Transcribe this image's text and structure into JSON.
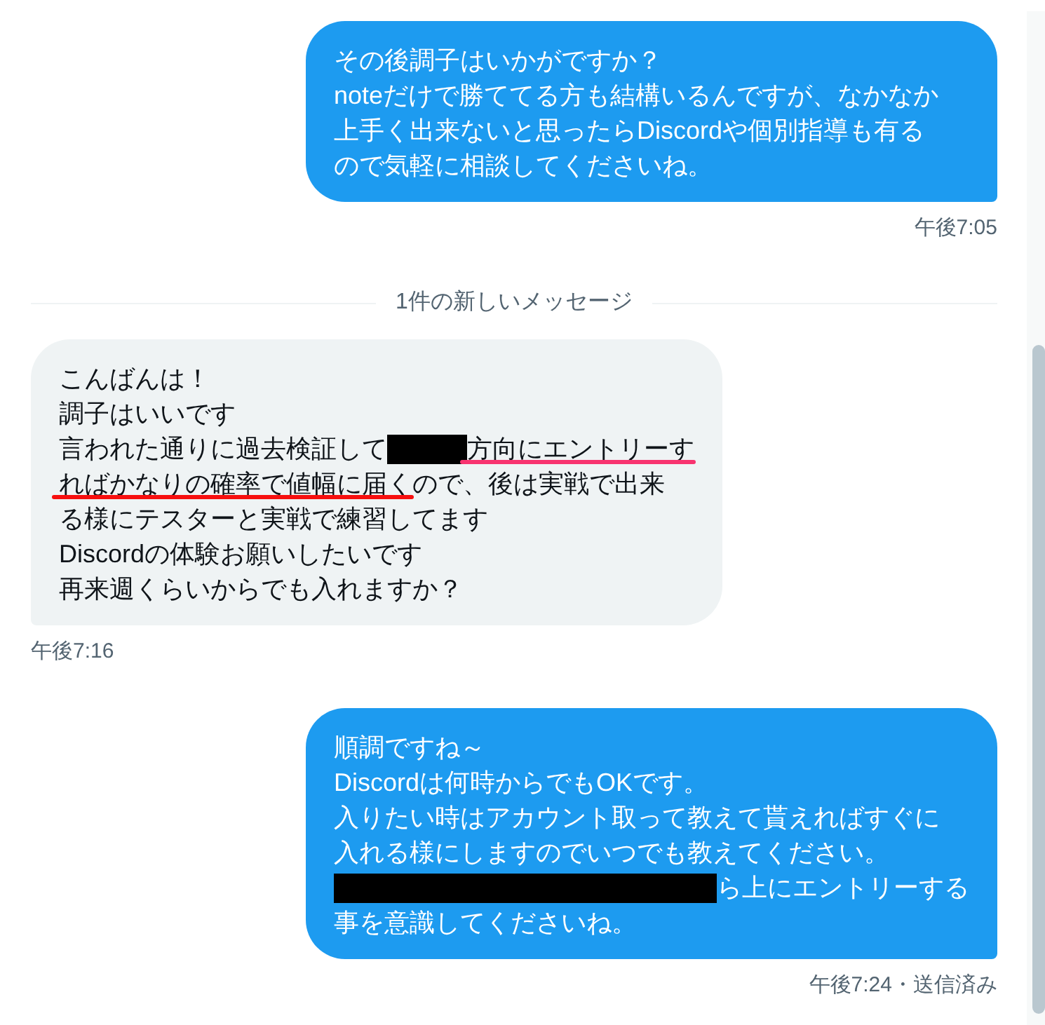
{
  "timeline": [
    {
      "kind": "sent",
      "lines": [
        [
          {
            "kind": "text",
            "text": "その後調子はいかがですか？"
          }
        ],
        [
          {
            "kind": "text",
            "text": "noteだけで勝ててる方も結構いるんですが、なかなか"
          }
        ],
        [
          {
            "kind": "text",
            "text": "上手く出来ないと思ったらDiscordや個別指導も有る"
          }
        ],
        [
          {
            "kind": "text",
            "text": "ので気軽に相談してくださいね。"
          }
        ]
      ],
      "time": "午後7:05"
    },
    {
      "kind": "divider",
      "label": "1件の新しいメッセージ"
    },
    {
      "kind": "received",
      "lines": [
        [
          {
            "kind": "text",
            "text": "こんばんは！"
          }
        ],
        [
          {
            "kind": "text",
            "text": "調子はいいです"
          }
        ],
        [
          {
            "kind": "text",
            "text": "言われた通りに過去検証して"
          },
          {
            "kind": "redaction"
          },
          {
            "kind": "underlined",
            "text": "方向にエントリーす",
            "color": "#f8336f"
          }
        ],
        [
          {
            "kind": "underlined",
            "text": "ればかなりの確率で値幅に届く",
            "color": "#f70f0f"
          },
          {
            "kind": "text",
            "text": "ので、後は実戦で出来"
          }
        ],
        [
          {
            "kind": "text",
            "text": "る様にテスターと実戦で練習してます"
          }
        ],
        [
          {
            "kind": "text",
            "text": "Discordの体験お願いしたいです"
          }
        ],
        [
          {
            "kind": "text",
            "text": "再来週くらいからでも入れますか？"
          }
        ]
      ],
      "time": "午後7:16"
    },
    {
      "kind": "sent",
      "lines": [
        [
          {
            "kind": "text",
            "text": "順調ですね～"
          }
        ],
        [
          {
            "kind": "text",
            "text": "Discordは何時からでもOKです。"
          }
        ],
        [
          {
            "kind": "text",
            "text": "入りたい時はアカウント取って教えて貰えればすぐに"
          }
        ],
        [
          {
            "kind": "text",
            "text": "入れる様にしますのでいつでも教えてください。"
          }
        ],
        [
          {
            "kind": "redaction"
          },
          {
            "kind": "text",
            "text": "ら上にエントリーする"
          }
        ],
        [
          {
            "kind": "text",
            "text": "事を意識してくださいね。"
          }
        ]
      ],
      "time": "午後7:24・送信済み"
    }
  ]
}
